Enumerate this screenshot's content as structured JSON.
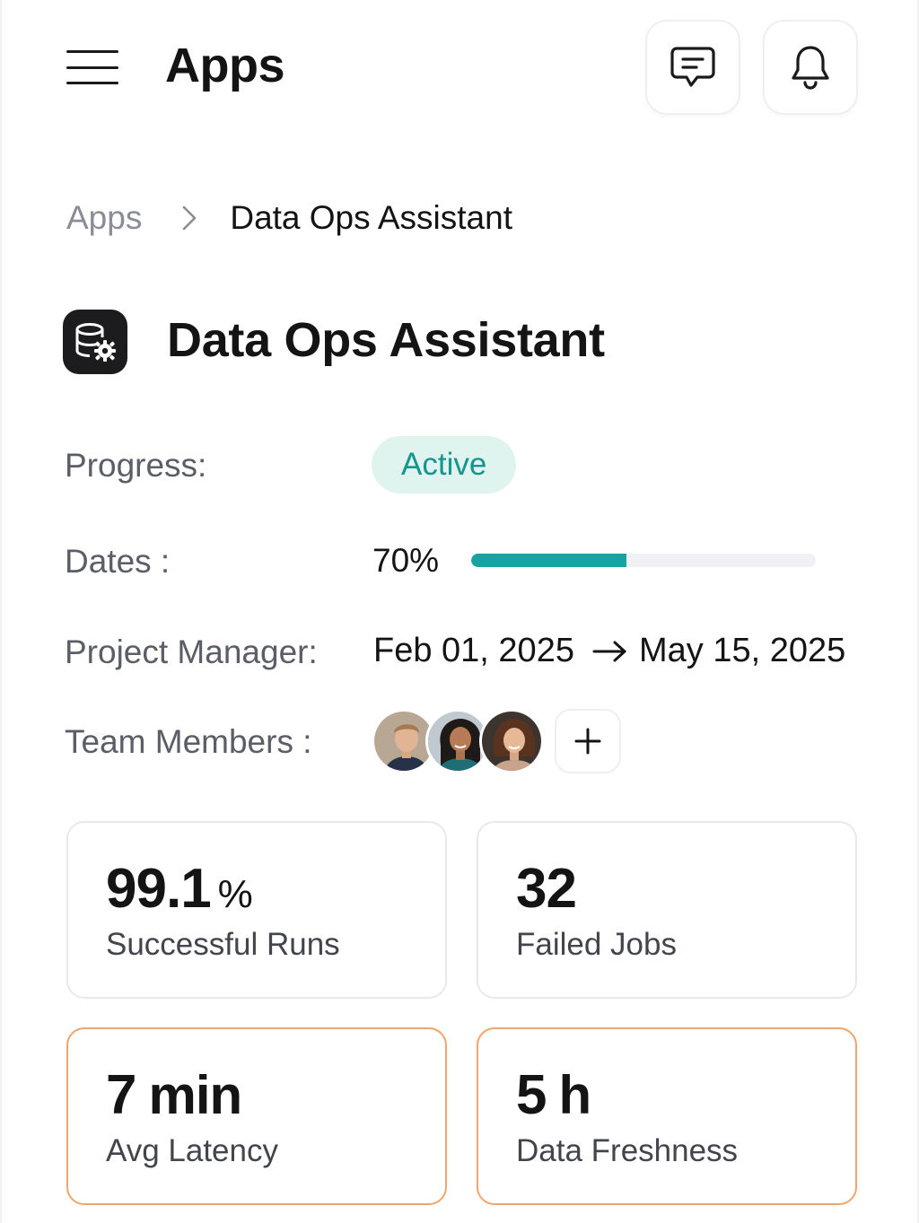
{
  "header": {
    "title": "Apps",
    "menu_icon": "hamburger-menu-icon",
    "chat_icon": "chat-bubble-icon",
    "bell_icon": "bell-icon"
  },
  "breadcrumb": {
    "root": "Apps",
    "separator_icon": "chevron-right-icon",
    "current": "Data Ops Assistant"
  },
  "project": {
    "icon": "database-gear-icon",
    "title": "Data Ops Assistant"
  },
  "info": {
    "progress_label": "Progress:",
    "status": "Active",
    "dates_label": "Dates :",
    "progress_percent_text": "70%",
    "progress_fraction": 0.45,
    "manager_label": "Project Manager:",
    "start_date": "Feb 01, 2025",
    "arrow_icon": "arrow-right-icon",
    "end_date": "May 15, 2025",
    "team_label": "Team Members :",
    "team_members": [
      {
        "name": "avatar-1"
      },
      {
        "name": "avatar-2"
      },
      {
        "name": "avatar-3"
      }
    ],
    "add_member_icon": "plus-icon"
  },
  "stats": [
    {
      "value": "99.1",
      "unit": "%",
      "caption": "Successful Runs"
    },
    {
      "value": "32",
      "unit": "",
      "caption": "Failed Jobs"
    },
    {
      "value": "7",
      "unit": "min",
      "caption": "Avg Latency"
    },
    {
      "value": "5",
      "unit": "h",
      "caption": "Data Freshness"
    }
  ],
  "colors": {
    "accent": "#17a3a1",
    "status_bg": "#dff3ef",
    "warning_border": "#f3a46a"
  }
}
